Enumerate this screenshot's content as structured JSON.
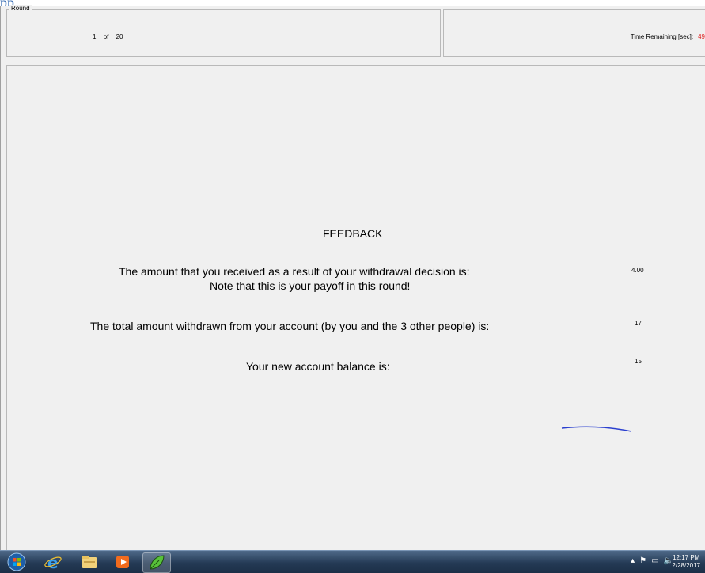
{
  "header_label": "pp",
  "round_group": {
    "legend": "Round",
    "current": "1",
    "of_label": "of",
    "total": "20"
  },
  "time_group": {
    "label": "Time Remaining [sec]:",
    "value": "49"
  },
  "feedback": {
    "title": "FEEDBACK",
    "received_line1": "The amount that you received as a result of your withdrawal decision is:",
    "received_line2": "Note that this is your payoff in this round!",
    "received_value": "4.00",
    "withdrawn_text": "The total amount withdrawn from your account (by you and the 3 other people) is:",
    "withdrawn_value": "17",
    "balance_text": "Your new account balance is:",
    "balance_value": "15"
  },
  "colors": {
    "time_value": "#e02020",
    "pen_stroke": "#2a3fcf"
  },
  "taskbar": {
    "icons": [
      "start-orb-icon",
      "internet-explorer-icon",
      "file-explorer-icon",
      "media-player-icon",
      "leaf-app-icon"
    ],
    "clock_time": "12:17 PM",
    "clock_date": "2/28/2017"
  }
}
